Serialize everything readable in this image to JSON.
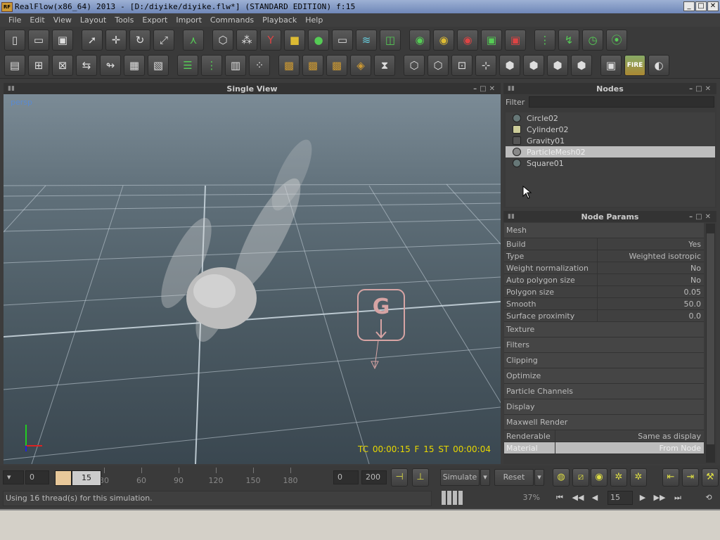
{
  "window": {
    "title": "RealFlow(x86_64) 2013 - [D:/diyike/diyike.flw*] (STANDARD EDITION) f:15",
    "app_icon": "RF",
    "minimize": "_",
    "maximize": "□",
    "close": "✕"
  },
  "menu": [
    "File",
    "Edit",
    "View",
    "Layout",
    "Tools",
    "Export",
    "Import",
    "Commands",
    "Playback",
    "Help"
  ],
  "toolbar_fire_label": "FIRE",
  "viewport": {
    "title": "Single View",
    "camera_label": "persp",
    "hud": "TC 00:00:15  F 15  ST 00:00:04"
  },
  "nodes": {
    "title": "Nodes",
    "filter_label": "Filter",
    "items": [
      "Circle02",
      "Cylinder02",
      "Gravity01",
      "ParticleMesh02",
      "Square01"
    ],
    "selected": "ParticleMesh02"
  },
  "params": {
    "title": "Node Params",
    "mesh_section": "Mesh",
    "mesh_rows": [
      {
        "k": "Build",
        "v": "Yes"
      },
      {
        "k": "Type",
        "v": "Weighted isotropic"
      },
      {
        "k": "Weight normalization",
        "v": "No"
      },
      {
        "k": "Auto polygon size",
        "v": "No"
      },
      {
        "k": "Polygon size",
        "v": "0.05"
      },
      {
        "k": "Smooth",
        "v": "50.0"
      },
      {
        "k": "Surface proximity",
        "v": "0.0"
      }
    ],
    "sections": [
      "Texture",
      "Filters",
      "Clipping",
      "Optimize",
      "Particle Channels",
      "Display",
      "Maxwell Render"
    ],
    "render_rows": [
      {
        "k": "Renderable",
        "v": "Same as display"
      },
      {
        "k": "Material",
        "v": "From Node"
      }
    ]
  },
  "timeline": {
    "start": "0",
    "current": "15",
    "ticks": [
      "30",
      "60",
      "90",
      "120",
      "150",
      "180"
    ],
    "range_start": "0",
    "range_end": "200",
    "simulate": "Simulate",
    "reset": "Reset"
  },
  "status": {
    "message": "Using 16 thread(s) for this simulation.",
    "progress_pct": "37%",
    "frame": "15"
  }
}
